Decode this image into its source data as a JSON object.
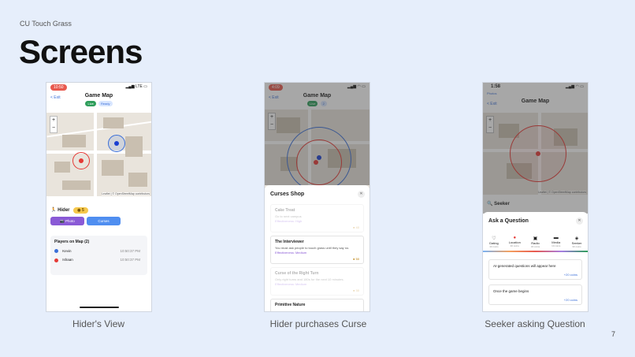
{
  "slide": {
    "brand": "CU Touch Grass",
    "title": "Screens",
    "page_number": "7"
  },
  "captions": [
    "Hider's View",
    "Hider purchases Curse",
    "Seeker asking Question"
  ],
  "common": {
    "exit_label": "< Exit",
    "map_title": "Game Map",
    "badge_live": "Live",
    "badge_ready": "Ready",
    "badge_count": "2",
    "attribution": "Leaflet | © OpenStreetMap contributors"
  },
  "screen1": {
    "time": "10:50",
    "status": "LTE",
    "role": "Hider",
    "coins": "5",
    "photo_button": "Photo",
    "curses_button": "Curses",
    "players_title": "Players on Map (2)",
    "players": [
      {
        "name": "Kevin",
        "time": "10:50:37 PM",
        "color": "#3b6fd8"
      },
      {
        "name": "Ishaan",
        "time": "10:50:37 PM",
        "color": "#e53935"
      }
    ]
  },
  "screen2": {
    "time": "4:09",
    "shop_title": "Curses Shop",
    "cards": [
      {
        "title": "Cake Treat",
        "desc": "Go to next campus",
        "effect": "Effectiveness: High",
        "cost": "40",
        "faded": true
      },
      {
        "title": "The Interviewer",
        "desc": "You must ask people to touch grass until they say no.",
        "effect": "Effectiveness: Medium",
        "cost": "50",
        "faded": false
      },
      {
        "title": "Curse of the Right Turn",
        "desc": "Only right turns and 180s for the next 10 minutes.",
        "effect": "Effectiveness: Medium",
        "cost": "30",
        "faded": true
      },
      {
        "title": "Primitive Nature",
        "desc": "",
        "effect": "",
        "cost": "",
        "faded": false
      }
    ]
  },
  "screen3": {
    "time": "1:58",
    "back": "Photos",
    "role": "Seeker",
    "sheet_title": "Ask a Question",
    "categories": [
      {
        "label": "Dating",
        "sub": "40 coins"
      },
      {
        "label": "Location",
        "sub": "30 coins"
      },
      {
        "label": "Radio",
        "sub": "30 coins"
      },
      {
        "label": "Media",
        "sub": "10 coins"
      },
      {
        "label": "Seeker",
        "sub": "30 coins"
      }
    ],
    "questions": [
      {
        "text": "AI-generated questions will appear here",
        "coins": "+20 coins"
      },
      {
        "text": "Once the game begins",
        "coins": "+20 coins"
      }
    ]
  }
}
